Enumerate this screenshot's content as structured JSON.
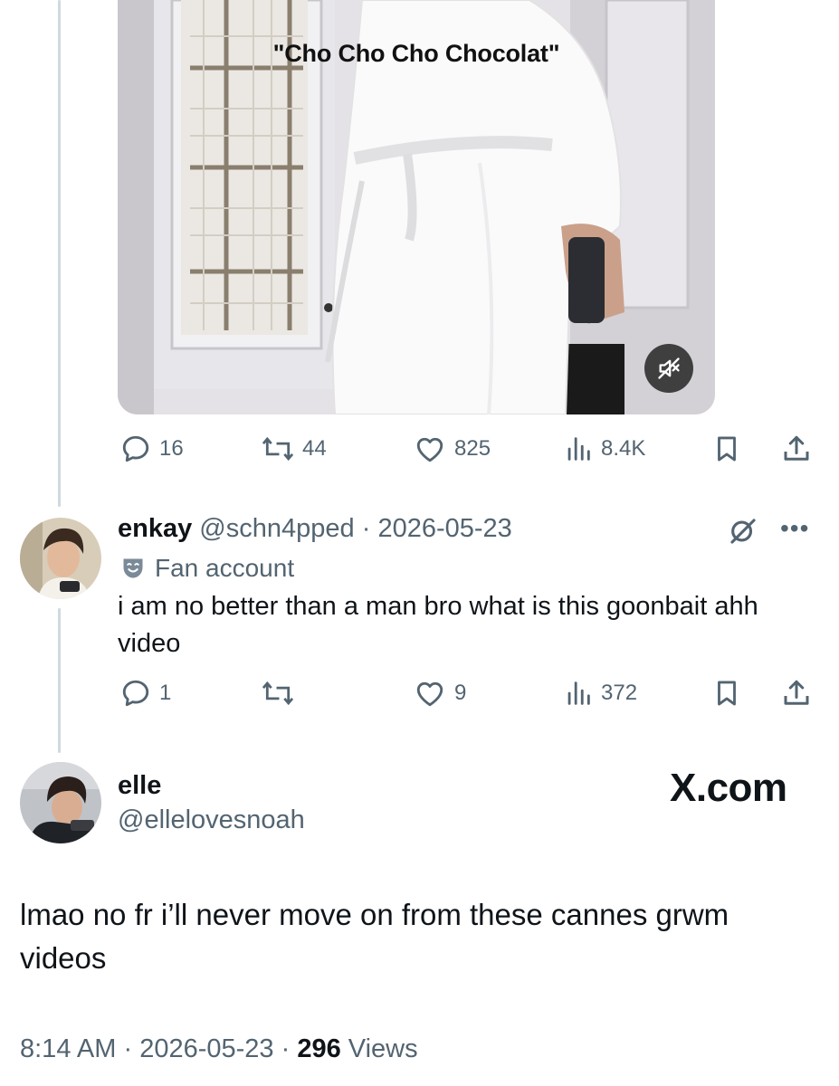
{
  "video": {
    "caption": "\"Cho Cho Cho Chocolat\"",
    "mute_icon": "speaker-muted-icon"
  },
  "video_actions": {
    "replies": "16",
    "reposts": "44",
    "likes": "825",
    "views": "8.4K"
  },
  "reply": {
    "display_name": "enkay",
    "handle": "@schn4pped",
    "separator": "·",
    "date": "2026-05-23",
    "badge": "Fan account",
    "text": "i am no better than a man bro what is this goonbait ahh video",
    "actions": {
      "replies": "1",
      "reposts": "",
      "likes": "9",
      "views": "372"
    }
  },
  "main_tweet": {
    "display_name": "elle",
    "handle": "@ellelovesnoah",
    "watermark": "X.com",
    "text": "lmao no fr i’ll never move on from these cannes grwm videos",
    "time": "8:14 AM",
    "sep1": "·",
    "date": "2026-05-23",
    "sep2": "·",
    "views_count": "296",
    "views_label": "Views"
  },
  "colors": {
    "text": "#0f1419",
    "muted": "#536471",
    "thread_line": "#cfd9de"
  }
}
